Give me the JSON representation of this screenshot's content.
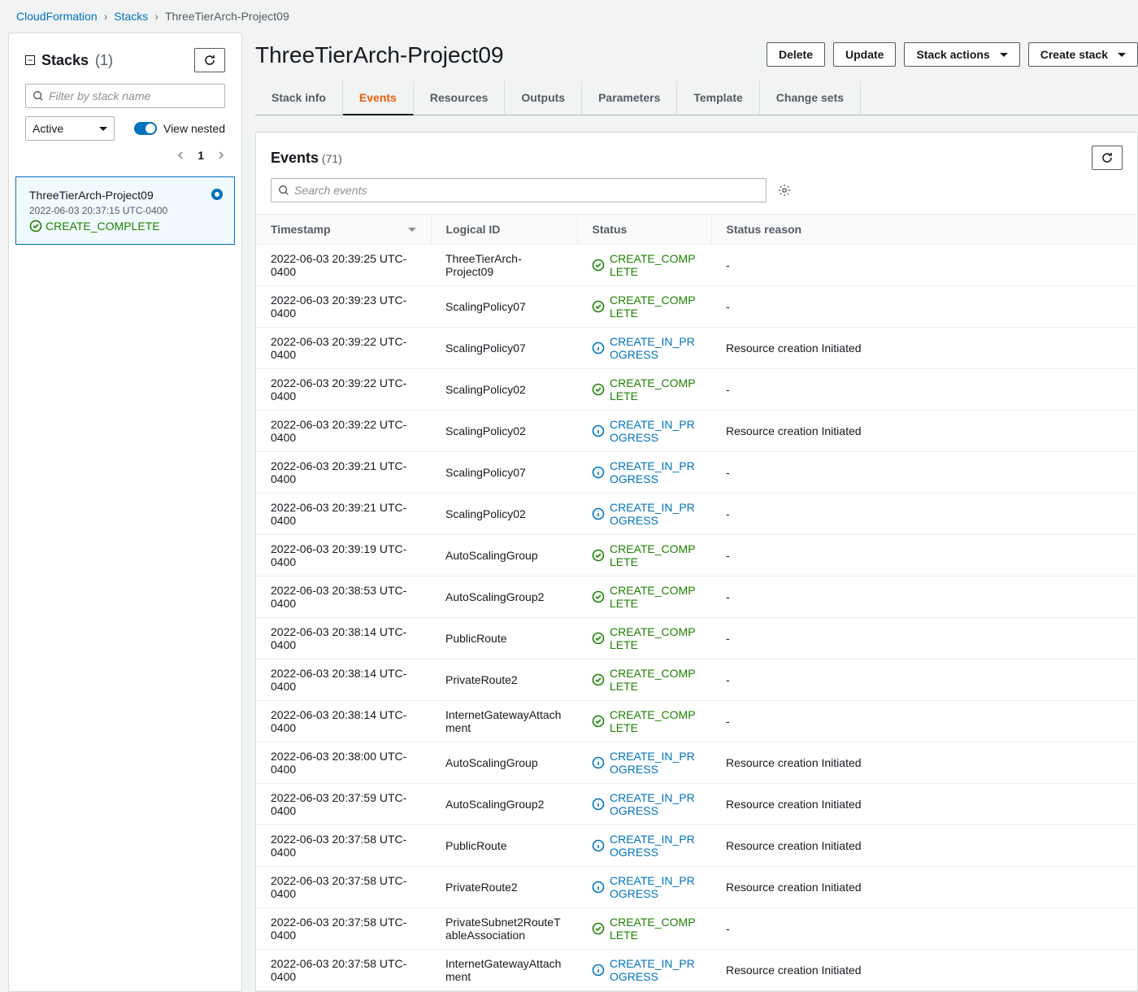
{
  "breadcrumbs": {
    "root": "CloudFormation",
    "stacks": "Stacks",
    "current": "ThreeTierArch-Project09"
  },
  "sidebar": {
    "title": "Stacks",
    "count": "(1)",
    "filter_placeholder": "Filter by stack name",
    "dropdown_value": "Active",
    "view_nested_label": "View nested",
    "page": "1",
    "stack": {
      "name": "ThreeTierArch-Project09",
      "time": "2022-06-03 20:37:15 UTC-0400",
      "status": "CREATE_COMPLETE"
    }
  },
  "main": {
    "title": "ThreeTierArch-Project09",
    "buttons": {
      "delete": "Delete",
      "update": "Update",
      "stack_actions": "Stack actions",
      "create_stack": "Create stack"
    },
    "tabs": {
      "stack_info": "Stack info",
      "events": "Events",
      "resources": "Resources",
      "outputs": "Outputs",
      "parameters": "Parameters",
      "template": "Template",
      "change_sets": "Change sets"
    }
  },
  "events": {
    "title": "Events",
    "count": "(71)",
    "search_placeholder": "Search events",
    "columns": {
      "timestamp": "Timestamp",
      "logical_id": "Logical ID",
      "status": "Status",
      "status_reason": "Status reason"
    },
    "rows": [
      {
        "ts": "2022-06-03 20:39:25 UTC-0400",
        "lid": "ThreeTierArch-Project09",
        "status": "CREATE_COMPLETE",
        "type": "complete",
        "reason": "-"
      },
      {
        "ts": "2022-06-03 20:39:23 UTC-0400",
        "lid": "ScalingPolicy07",
        "status": "CREATE_COMPLETE",
        "type": "complete",
        "reason": "-"
      },
      {
        "ts": "2022-06-03 20:39:22 UTC-0400",
        "lid": "ScalingPolicy07",
        "status": "CREATE_IN_PROGRESS",
        "type": "progress",
        "reason": "Resource creation Initiated"
      },
      {
        "ts": "2022-06-03 20:39:22 UTC-0400",
        "lid": "ScalingPolicy02",
        "status": "CREATE_COMPLETE",
        "type": "complete",
        "reason": "-"
      },
      {
        "ts": "2022-06-03 20:39:22 UTC-0400",
        "lid": "ScalingPolicy02",
        "status": "CREATE_IN_PROGRESS",
        "type": "progress",
        "reason": "Resource creation Initiated"
      },
      {
        "ts": "2022-06-03 20:39:21 UTC-0400",
        "lid": "ScalingPolicy07",
        "status": "CREATE_IN_PROGRESS",
        "type": "progress",
        "reason": "-"
      },
      {
        "ts": "2022-06-03 20:39:21 UTC-0400",
        "lid": "ScalingPolicy02",
        "status": "CREATE_IN_PROGRESS",
        "type": "progress",
        "reason": "-"
      },
      {
        "ts": "2022-06-03 20:39:19 UTC-0400",
        "lid": "AutoScalingGroup",
        "status": "CREATE_COMPLETE",
        "type": "complete",
        "reason": "-"
      },
      {
        "ts": "2022-06-03 20:38:53 UTC-0400",
        "lid": "AutoScalingGroup2",
        "status": "CREATE_COMPLETE",
        "type": "complete",
        "reason": "-"
      },
      {
        "ts": "2022-06-03 20:38:14 UTC-0400",
        "lid": "PublicRoute",
        "status": "CREATE_COMPLETE",
        "type": "complete",
        "reason": "-"
      },
      {
        "ts": "2022-06-03 20:38:14 UTC-0400",
        "lid": "PrivateRoute2",
        "status": "CREATE_COMPLETE",
        "type": "complete",
        "reason": "-"
      },
      {
        "ts": "2022-06-03 20:38:14 UTC-0400",
        "lid": "InternetGatewayAttachment",
        "status": "CREATE_COMPLETE",
        "type": "complete",
        "reason": "-"
      },
      {
        "ts": "2022-06-03 20:38:00 UTC-0400",
        "lid": "AutoScalingGroup",
        "status": "CREATE_IN_PROGRESS",
        "type": "progress",
        "reason": "Resource creation Initiated"
      },
      {
        "ts": "2022-06-03 20:37:59 UTC-0400",
        "lid": "AutoScalingGroup2",
        "status": "CREATE_IN_PROGRESS",
        "type": "progress",
        "reason": "Resource creation Initiated"
      },
      {
        "ts": "2022-06-03 20:37:58 UTC-0400",
        "lid": "PublicRoute",
        "status": "CREATE_IN_PROGRESS",
        "type": "progress",
        "reason": "Resource creation Initiated"
      },
      {
        "ts": "2022-06-03 20:37:58 UTC-0400",
        "lid": "PrivateRoute2",
        "status": "CREATE_IN_PROGRESS",
        "type": "progress",
        "reason": "Resource creation Initiated"
      },
      {
        "ts": "2022-06-03 20:37:58 UTC-0400",
        "lid": "PrivateSubnet2RouteTableAssociation",
        "status": "CREATE_COMPLETE",
        "type": "complete",
        "reason": "-"
      },
      {
        "ts": "2022-06-03 20:37:58 UTC-0400",
        "lid": "InternetGatewayAttachment",
        "status": "CREATE_IN_PROGRESS",
        "type": "progress",
        "reason": "Resource creation Initiated"
      }
    ]
  }
}
